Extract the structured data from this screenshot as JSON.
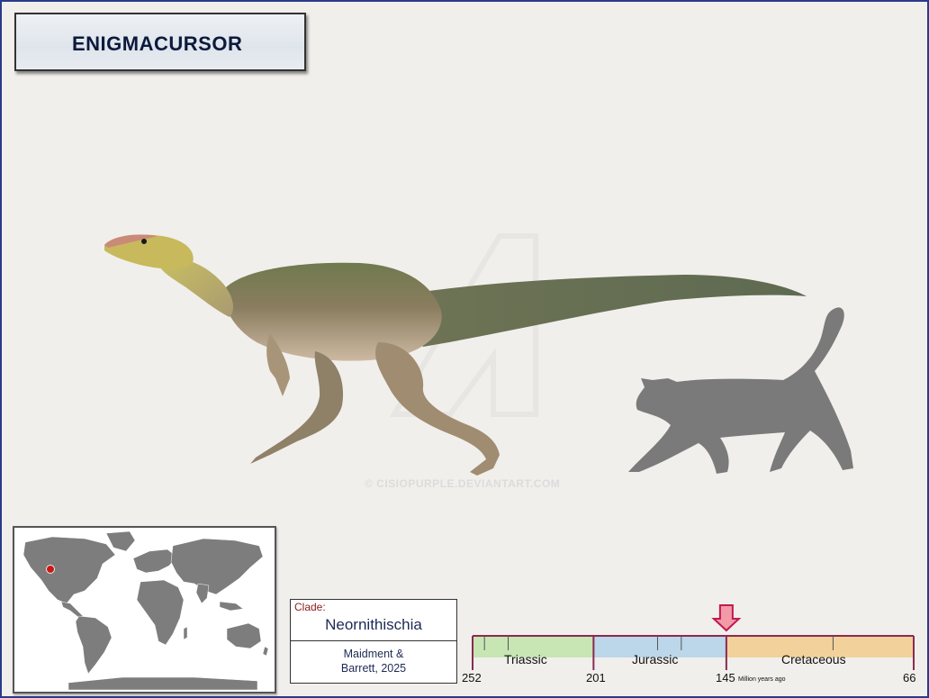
{
  "title": "ENIGMACURSOR",
  "watermark": "© CISIOPURPLE.DEVIANTART.COM",
  "clade": {
    "label": "Clade:",
    "name": "Neornithischia",
    "author_line1": "Maidment &",
    "author_line2": "Barrett, 2025"
  },
  "timeline": {
    "periods": [
      {
        "name": "Triassic",
        "start": 252,
        "end": 201,
        "color": "#c8e6b4"
      },
      {
        "name": "Jurassic",
        "start": 201,
        "end": 145,
        "color": "#bcd6ea"
      },
      {
        "name": "Cretaceous",
        "start": 145,
        "end": 66,
        "color": "#f2d29a"
      }
    ],
    "ticks": [
      "252",
      "201",
      "145",
      "66"
    ],
    "unit": "Million years ago",
    "marker_mya": 145,
    "marker_color": "#f29aa8"
  },
  "map": {
    "locality": "North America (western USA)",
    "marker_color": "#c81818"
  },
  "silhouette": "cat-silhouette",
  "colors": {
    "frame": "#2a3a8c",
    "title_text": "#0c1a3c",
    "clade_text": "#1d2a55",
    "clade_label": "#8b1a1a"
  }
}
